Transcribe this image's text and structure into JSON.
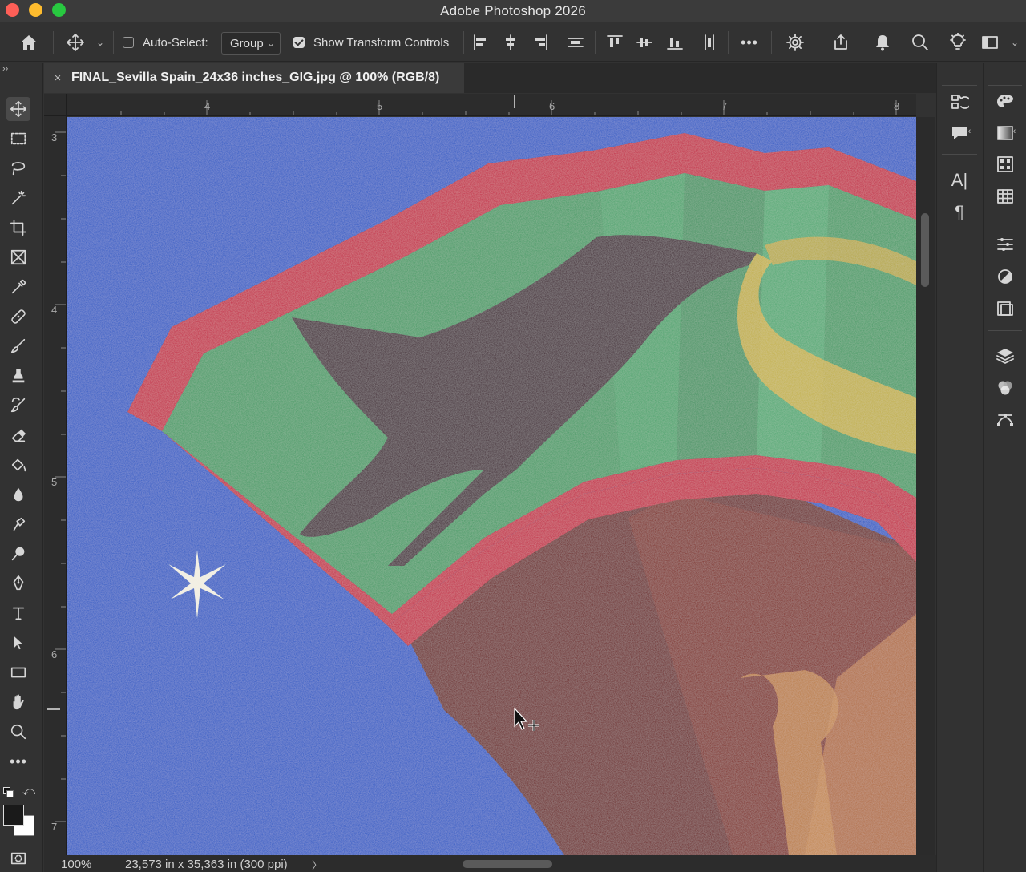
{
  "window": {
    "title": "Adobe Photoshop 2026"
  },
  "options_bar": {
    "auto_select_label": "Auto-Select:",
    "auto_select_checked": false,
    "auto_select_target": "Group",
    "show_transform_label": "Show Transform Controls",
    "show_transform_checked": true,
    "more_label": "•••"
  },
  "document": {
    "tab_name": "FINAL_Sevilla Spain_24x36 inches_GIG.jpg @ 100% (RGB/8)",
    "close_glyph": "×"
  },
  "rulers": {
    "top": [
      "4",
      "5",
      "6",
      "7",
      "8"
    ],
    "left": [
      "3",
      "4",
      "5",
      "6",
      "7"
    ]
  },
  "status": {
    "zoom": "100%",
    "dimensions": "23,573 in x 35,363 in (300 ppi)",
    "arrow": "〉"
  },
  "tools": [
    "move-tool",
    "marquee-tool",
    "lasso-tool",
    "magic-wand-tool",
    "crop-tool",
    "frame-tool",
    "eyedropper-tool",
    "healing-brush-tool",
    "brush-tool",
    "clone-stamp-tool",
    "history-brush-tool",
    "eraser-tool",
    "paint-bucket-tool",
    "blur-tool",
    "smudge-tool",
    "dodge-tool",
    "pen-tool",
    "type-tool",
    "path-selection-tool",
    "rectangle-tool",
    "hand-tool",
    "zoom-tool",
    "edit-toolbar",
    "default-colors",
    "swap-colors",
    "color-swatches",
    "quick-mask"
  ],
  "colors": {
    "foreground": "#1a1a1a",
    "background": "#ffffff",
    "canvas_blue": "#2457c4",
    "fan_red": "#c2163c",
    "fan_green": "#3f9a62",
    "bird_dark": "#3a1f2a"
  }
}
